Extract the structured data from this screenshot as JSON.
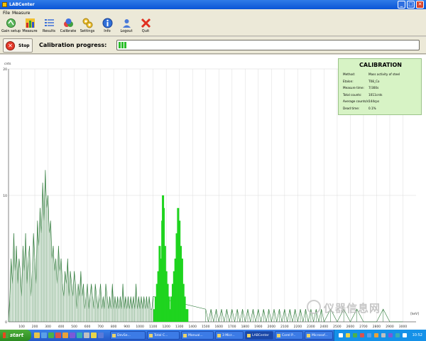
{
  "window": {
    "title": "LABCenter"
  },
  "menu": [
    "File",
    "Measure"
  ],
  "toolbar": {
    "buttons": [
      {
        "label": "Gain setup",
        "icon": "gain-icon"
      },
      {
        "label": "Measure",
        "icon": "measure-icon"
      },
      {
        "label": "Results",
        "icon": "results-icon"
      },
      {
        "label": "Calibrate",
        "icon": "calibrate-icon"
      },
      {
        "label": "Settings",
        "icon": "settings-icon"
      },
      {
        "label": "Info",
        "icon": "info-icon"
      },
      {
        "label": "Logout",
        "icon": "logout-icon"
      },
      {
        "label": "Quit",
        "icon": "quit-icon"
      }
    ]
  },
  "controls": {
    "stop_label": "Stop",
    "progress_label": "Calibration progress:",
    "progress_fraction": 0.025
  },
  "calibration": {
    "title": "CALIBRATION",
    "rows": [
      {
        "key": "Method:",
        "value": "Mass activity of steel"
      },
      {
        "key": "Etalon:",
        "value": "T08_Co"
      },
      {
        "key": "Measure time:",
        "value": "7/300s"
      },
      {
        "key": "Total counts:",
        "value": "1011cnts"
      },
      {
        "key": "Average counts/s:",
        "value": "144cps"
      },
      {
        "key": "Dead time:",
        "value": "0.1%"
      }
    ]
  },
  "chart_data": {
    "type": "bar",
    "ylabel": "cnts",
    "xlabel": "[keV]",
    "xlim": [
      0,
      3100
    ],
    "ylim": [
      0,
      20
    ],
    "yticks": [
      0,
      10,
      20
    ],
    "xticks": [
      100,
      200,
      300,
      400,
      500,
      600,
      700,
      800,
      900,
      1000,
      1100,
      1200,
      1300,
      1400,
      1500,
      1600,
      1700,
      1800,
      1900,
      2000,
      2100,
      2200,
      2300,
      2400,
      2500,
      2600,
      2700,
      2800,
      2900,
      3000
    ],
    "grid": true,
    "background_series": {
      "color": "#2f7a3a",
      "points": [
        [
          0,
          0
        ],
        [
          10,
          2
        ],
        [
          20,
          5
        ],
        [
          30,
          3
        ],
        [
          40,
          7
        ],
        [
          50,
          4
        ],
        [
          60,
          6
        ],
        [
          70,
          3
        ],
        [
          80,
          5
        ],
        [
          90,
          4
        ],
        [
          100,
          2
        ],
        [
          110,
          6
        ],
        [
          120,
          4
        ],
        [
          130,
          7
        ],
        [
          140,
          3
        ],
        [
          150,
          5
        ],
        [
          160,
          6
        ],
        [
          170,
          2
        ],
        [
          180,
          4
        ],
        [
          190,
          7
        ],
        [
          200,
          5
        ],
        [
          210,
          3
        ],
        [
          220,
          8
        ],
        [
          230,
          6
        ],
        [
          240,
          9
        ],
        [
          250,
          7
        ],
        [
          260,
          11
        ],
        [
          270,
          8
        ],
        [
          280,
          12
        ],
        [
          290,
          9
        ],
        [
          300,
          10
        ],
        [
          310,
          7
        ],
        [
          320,
          8
        ],
        [
          330,
          5
        ],
        [
          340,
          6
        ],
        [
          350,
          4
        ],
        [
          360,
          5
        ],
        [
          370,
          3
        ],
        [
          380,
          6
        ],
        [
          390,
          4
        ],
        [
          400,
          5
        ],
        [
          410,
          3
        ],
        [
          420,
          2
        ],
        [
          430,
          4
        ],
        [
          440,
          3
        ],
        [
          450,
          5
        ],
        [
          460,
          2
        ],
        [
          470,
          4
        ],
        [
          480,
          3
        ],
        [
          490,
          2
        ],
        [
          500,
          4
        ],
        [
          510,
          3
        ],
        [
          520,
          1
        ],
        [
          530,
          3
        ],
        [
          540,
          2
        ],
        [
          550,
          4
        ],
        [
          560,
          2
        ],
        [
          570,
          3
        ],
        [
          580,
          1
        ],
        [
          590,
          2
        ],
        [
          600,
          3
        ],
        [
          610,
          1
        ],
        [
          620,
          2
        ],
        [
          630,
          3
        ],
        [
          640,
          2
        ],
        [
          650,
          1
        ],
        [
          660,
          3
        ],
        [
          670,
          2
        ],
        [
          680,
          1
        ],
        [
          690,
          2
        ],
        [
          700,
          3
        ],
        [
          710,
          1
        ],
        [
          720,
          2
        ],
        [
          730,
          1
        ],
        [
          740,
          3
        ],
        [
          750,
          2
        ],
        [
          760,
          1
        ],
        [
          770,
          2
        ],
        [
          780,
          1
        ],
        [
          790,
          3
        ],
        [
          800,
          1
        ],
        [
          810,
          2
        ],
        [
          820,
          1
        ],
        [
          830,
          2
        ],
        [
          840,
          1
        ],
        [
          850,
          2
        ],
        [
          860,
          1
        ],
        [
          870,
          3
        ],
        [
          880,
          1
        ],
        [
          890,
          2
        ],
        [
          900,
          1
        ],
        [
          910,
          2
        ],
        [
          920,
          1
        ],
        [
          930,
          2
        ],
        [
          940,
          1
        ],
        [
          950,
          2
        ],
        [
          960,
          1
        ],
        [
          970,
          3
        ],
        [
          980,
          1
        ],
        [
          990,
          2
        ],
        [
          1000,
          1
        ],
        [
          1010,
          2
        ],
        [
          1020,
          1
        ],
        [
          1030,
          2
        ],
        [
          1040,
          1
        ],
        [
          1050,
          2
        ],
        [
          1060,
          1
        ],
        [
          1070,
          2
        ],
        [
          1080,
          1
        ],
        [
          1090,
          1
        ],
        [
          1100,
          2
        ],
        [
          1500,
          1
        ],
        [
          1520,
          0
        ],
        [
          1540,
          1
        ],
        [
          1560,
          0
        ],
        [
          1580,
          1
        ],
        [
          1600,
          0
        ],
        [
          1620,
          1
        ],
        [
          1640,
          0
        ],
        [
          1660,
          1
        ],
        [
          1680,
          0
        ],
        [
          1700,
          1
        ],
        [
          1720,
          0
        ],
        [
          1740,
          1
        ],
        [
          1760,
          0
        ],
        [
          1780,
          1
        ],
        [
          1800,
          0
        ],
        [
          1820,
          1
        ],
        [
          1840,
          0
        ],
        [
          1860,
          1
        ],
        [
          1880,
          0
        ],
        [
          1900,
          1
        ],
        [
          1920,
          0
        ],
        [
          1940,
          1
        ],
        [
          1960,
          0
        ],
        [
          1980,
          1
        ],
        [
          2000,
          0
        ],
        [
          2020,
          1
        ],
        [
          2040,
          0
        ],
        [
          2060,
          1
        ],
        [
          2080,
          0
        ],
        [
          2100,
          1
        ],
        [
          2120,
          0
        ],
        [
          2140,
          1
        ],
        [
          2160,
          0
        ],
        [
          2180,
          1
        ],
        [
          2200,
          0
        ],
        [
          2220,
          1
        ],
        [
          2240,
          0
        ],
        [
          2260,
          1
        ],
        [
          2280,
          0
        ],
        [
          2300,
          1
        ],
        [
          2320,
          0
        ],
        [
          2340,
          1
        ],
        [
          2360,
          0
        ],
        [
          2380,
          1
        ],
        [
          2400,
          0
        ],
        [
          2450,
          1
        ],
        [
          2500,
          0
        ],
        [
          2550,
          1
        ],
        [
          2600,
          0
        ],
        [
          2650,
          1
        ],
        [
          2700,
          0
        ],
        [
          2750,
          0
        ],
        [
          2800,
          0
        ],
        [
          2850,
          1
        ],
        [
          2900,
          0
        ],
        [
          2950,
          0
        ],
        [
          3000,
          0
        ]
      ]
    },
    "peak_series": {
      "color": "#1fd41f",
      "points": [
        [
          1110,
          1
        ],
        [
          1120,
          2
        ],
        [
          1130,
          3
        ],
        [
          1140,
          4
        ],
        [
          1150,
          6
        ],
        [
          1160,
          5
        ],
        [
          1170,
          8
        ],
        [
          1175,
          10
        ],
        [
          1180,
          9
        ],
        [
          1190,
          6
        ],
        [
          1200,
          4
        ],
        [
          1210,
          3
        ],
        [
          1220,
          2
        ],
        [
          1230,
          1
        ],
        [
          1240,
          2
        ],
        [
          1250,
          3
        ],
        [
          1260,
          4
        ],
        [
          1270,
          5
        ],
        [
          1280,
          7
        ],
        [
          1290,
          9
        ],
        [
          1300,
          8
        ],
        [
          1310,
          6
        ],
        [
          1320,
          5
        ],
        [
          1330,
          3
        ],
        [
          1340,
          2
        ],
        [
          1350,
          1
        ],
        [
          1360,
          1
        ]
      ]
    }
  }
}
